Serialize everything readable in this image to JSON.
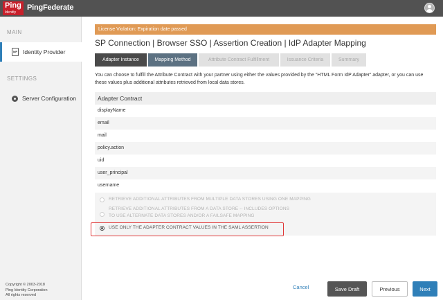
{
  "brand": {
    "logo_mark": "Ping",
    "logo_sub": "Identity",
    "product": "PingFederate"
  },
  "header": {
    "user_icon": "user-icon"
  },
  "sidebar": {
    "main_label": "MAIN",
    "identity_provider": "Identity Provider",
    "idp_badge": "IdP",
    "settings_label": "SETTINGS",
    "server_configuration": "Server Configuration",
    "copyright_line1": "Copyright © 2003-2018",
    "copyright_line2": "Ping Identity Corporation",
    "copyright_line3": "All rights reserved"
  },
  "license_banner": "License Violation: Expiration date passed",
  "breadcrumb": "SP Connection | Browser SSO | Assertion Creation | IdP Adapter Mapping",
  "tabs": [
    {
      "label": "Adapter Instance"
    },
    {
      "label": "Mapping Method"
    },
    {
      "label": "Attribute Contract Fulfillment"
    },
    {
      "label": "Issuance Criteria"
    },
    {
      "label": "Summary"
    }
  ],
  "description": "You can choose to fulfill the Attribute Contract with your partner using either the values provided by the \"HTML Form IdP Adapter\" adapter, or you can use these values plus additional attributes retrieved from local data stores.",
  "adapter_contract": {
    "heading": "Adapter Contract",
    "attributes": [
      "displayName",
      "email",
      "mail",
      "policy.action",
      "uid",
      "user_principal",
      "username"
    ]
  },
  "mapping_options": [
    {
      "label": "RETRIEVE ADDITIONAL ATTRIBUTES FROM MULTIPLE DATA STORES USING ONE MAPPING",
      "selected": false
    },
    {
      "label_line1": "RETRIEVE ADDITIONAL ATTRIBUTES FROM A DATA STORE -- INCLUDES OPTIONS",
      "label_line2": "TO USE ALTERNATE DATA STORES AND/OR A FAILSAFE MAPPING",
      "selected": false
    },
    {
      "label": "USE ONLY THE ADAPTER CONTRACT VALUES IN THE SAML ASSERTION",
      "selected": true
    }
  ],
  "footer": {
    "cancel": "Cancel",
    "save_draft": "Save Draft",
    "previous": "Previous",
    "next": "Next"
  },
  "colors": {
    "accent": "#2f7fb8",
    "brand_red": "#c8202b",
    "warning": "#e09a55",
    "highlight_box": "#e03535"
  }
}
